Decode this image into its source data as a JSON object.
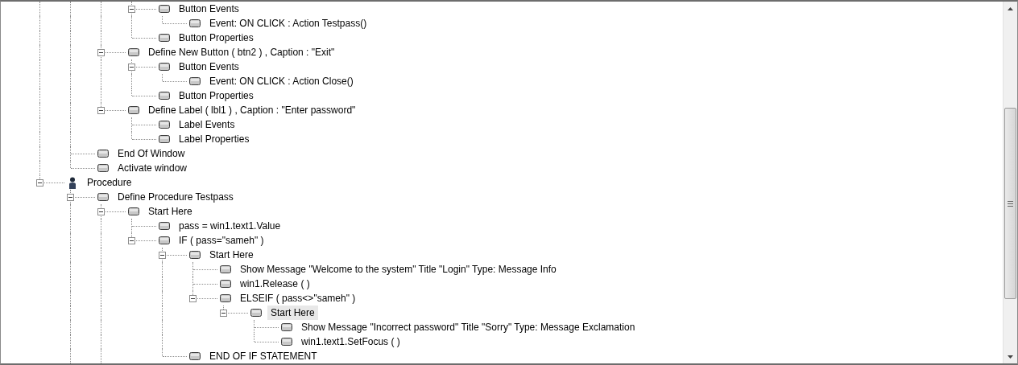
{
  "tree": [
    {
      "children": [
        {
          "children": [
            {
              "children": [
                {
                  "label": "Button Events",
                  "kind": "statement",
                  "expanded": true,
                  "selected": false,
                  "children": [
                    {
                      "label": "Event: ON CLICK : Action Testpass()",
                      "kind": "statement",
                      "selected": false
                    }
                  ]
                },
                {
                  "label": "Button Properties",
                  "kind": "statement",
                  "selected": false
                }
              ]
            },
            {
              "label": "Define New Button ( btn2 ) , Caption : \"Exit\"",
              "kind": "statement",
              "expanded": true,
              "selected": false,
              "children": [
                {
                  "label": "Button Events",
                  "kind": "statement",
                  "expanded": true,
                  "selected": false,
                  "children": [
                    {
                      "label": "Event: ON CLICK : Action Close()",
                      "kind": "statement",
                      "selected": false
                    }
                  ]
                },
                {
                  "label": "Button Properties",
                  "kind": "statement",
                  "selected": false
                }
              ]
            },
            {
              "label": "Define Label ( lbl1 ) , Caption : \"Enter password\"",
              "kind": "statement",
              "expanded": true,
              "selected": false,
              "children": [
                {
                  "label": "Label Events",
                  "kind": "statement",
                  "selected": false
                },
                {
                  "label": "Label Properties",
                  "kind": "statement",
                  "selected": false
                }
              ]
            }
          ]
        },
        {
          "label": "End Of Window",
          "kind": "statement",
          "selected": false
        },
        {
          "label": "Activate window",
          "kind": "statement",
          "selected": false
        }
      ]
    },
    {
      "label": "Procedure",
      "kind": "procedure",
      "expanded": true,
      "selected": false,
      "children": [
        {
          "label": "Define Procedure Testpass",
          "kind": "statement",
          "expanded": true,
          "selected": false,
          "more_below": true,
          "children": [
            {
              "label": "Start Here",
              "kind": "statement",
              "expanded": true,
              "selected": false,
              "more_below": true,
              "children": [
                {
                  "label": "pass = win1.text1.Value",
                  "kind": "statement",
                  "selected": false
                },
                {
                  "label": "IF ( pass=\"sameh\" )",
                  "kind": "statement",
                  "expanded": true,
                  "selected": false,
                  "children": [
                    {
                      "label": "Start Here",
                      "kind": "statement",
                      "expanded": true,
                      "selected": false,
                      "children": [
                        {
                          "label": "Show Message \"Welcome to the system\" Title \"Login\" Type: Message Info",
                          "kind": "statement",
                          "selected": false
                        },
                        {
                          "label": "win1.Release ( )",
                          "kind": "statement",
                          "selected": false
                        },
                        {
                          "label": "ELSEIF ( pass<>\"sameh\" )",
                          "kind": "statement",
                          "expanded": true,
                          "selected": false,
                          "children": [
                            {
                              "label": "Start Here",
                              "kind": "statement",
                              "expanded": true,
                              "selected": true,
                              "children": [
                                {
                                  "label": "Show Message \"Incorrect password\" Title \"Sorry\" Type: Message Exclamation",
                                  "kind": "statement",
                                  "selected": false
                                },
                                {
                                  "label": "win1.text1.SetFocus ( )",
                                  "kind": "statement",
                                  "selected": false
                                }
                              ]
                            }
                          ]
                        }
                      ]
                    },
                    {
                      "label": "END OF IF STATEMENT",
                      "kind": "statement",
                      "selected": false
                    }
                  ]
                }
              ]
            }
          ]
        }
      ]
    }
  ]
}
